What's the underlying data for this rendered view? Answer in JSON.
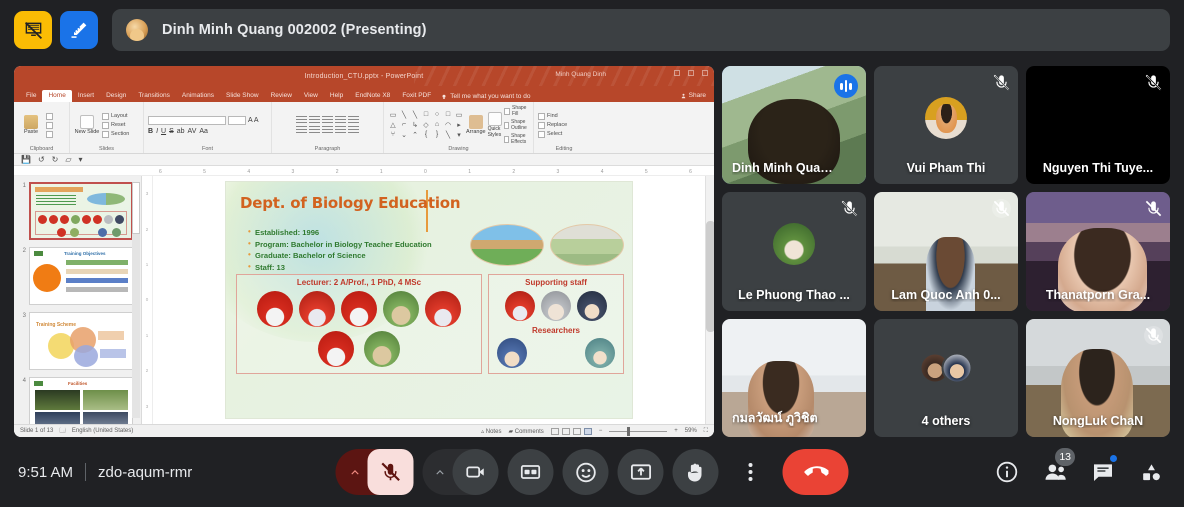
{
  "meeting": {
    "time": "9:51 AM",
    "code": "zdo-aqum-rmr",
    "presenter_banner": "Dinh Minh Quang 002002 (Presenting)",
    "accent_blue": "#1a73e8",
    "accent_yellow": "#fbbc04",
    "danger_red": "#ea4335",
    "surface": "#3c4043",
    "background": "#202124"
  },
  "topbar": {
    "stop_presenting_icon": "presentation-off-icon",
    "annotate_icon": "pen-annotate-icon",
    "avatar": "presenter-avatar"
  },
  "presentation": {
    "titlebar": "Introduction_CTU.pptx  -  PowerPoint",
    "user": "Minh Quang Dinh",
    "share_label": "Share",
    "tellme_placeholder": "Tell me what you want to do",
    "tabs": [
      "File",
      "Home",
      "Insert",
      "Design",
      "Transitions",
      "Animations",
      "Slide Show",
      "Review",
      "View",
      "Help",
      "EndNote X8",
      "Foxit PDF"
    ],
    "active_tab": "Home",
    "ribbon_groups": [
      {
        "name": "Clipboard",
        "items": [
          "Paste",
          "Cut",
          "Copy",
          "Format Painter"
        ]
      },
      {
        "name": "Slides",
        "items": [
          "New Slide",
          "Layout",
          "Reset",
          "Section"
        ]
      },
      {
        "name": "Font",
        "items": [
          "B",
          "I",
          "U",
          "S",
          "ab",
          "AV",
          "Aa"
        ]
      },
      {
        "name": "Paragraph",
        "items": []
      },
      {
        "name": "Drawing",
        "items": [
          "Arrange",
          "Quick Styles",
          "Shape Fill",
          "Shape Outline",
          "Shape Effects"
        ]
      },
      {
        "name": "Editing",
        "items": [
          "Find",
          "Replace",
          "Select"
        ]
      }
    ],
    "status": {
      "slide_counter": "Slide 1 of 13",
      "language": "English (United States)",
      "notes_label": "Notes",
      "comments_label": "Comments",
      "zoom": "59%"
    },
    "thumbnails": [
      {
        "number": "1",
        "caption": "Dept. of Biology Education",
        "selected": true
      },
      {
        "number": "2",
        "caption": "Training Objectives",
        "selected": false
      },
      {
        "number": "3",
        "caption": "Training Scheme",
        "selected": false
      },
      {
        "number": "4",
        "caption": "Facilities",
        "selected": false
      }
    ],
    "slide": {
      "title": "Dept. of Biology Education",
      "bullets": [
        "Established: 1996",
        "Program: Bachelor in Biology Teacher Education",
        "Graduate: Bachelor of Science",
        "Staff: 13"
      ],
      "panel_left_heading": "Lecturer: 2 A/Prof., 1 PhD, 4 MSc",
      "panel_right_heading": "Supporting staff",
      "researchers_heading": "Researchers",
      "lecturer_count": 7,
      "supporting_count": 3,
      "researcher_count": 2
    }
  },
  "tiles": [
    {
      "name": "Dinh Minh Quan...",
      "full": "Dinh Minh Quang 002002",
      "muted": false,
      "speaking": true,
      "active": true,
      "kind": "video-greenhouse",
      "name_align": "left"
    },
    {
      "name": "Vui Pham Thi",
      "muted": true,
      "speaking": false,
      "active": false,
      "kind": "avatar-vui",
      "name_align": "center"
    },
    {
      "name": "Nguyen Thi Tuye...",
      "muted": true,
      "speaking": false,
      "active": false,
      "kind": "camera-off-black",
      "name_align": "center"
    },
    {
      "name": "Le Phuong Thao ...",
      "muted": true,
      "speaking": false,
      "active": false,
      "kind": "avatar-thao",
      "name_align": "center"
    },
    {
      "name": "Lam Quoc Anh 0...",
      "muted": true,
      "speaking": false,
      "active": false,
      "kind": "video-office",
      "name_align": "center"
    },
    {
      "name": "Thanatporn Gra...",
      "muted": true,
      "speaking": false,
      "active": false,
      "kind": "video-temple",
      "name_align": "center"
    },
    {
      "name": "กมลวัฒน์ ภูวิชิต",
      "muted": false,
      "speaking": false,
      "active": false,
      "kind": "video-white-room",
      "name_align": "left"
    },
    {
      "name": "4 others",
      "muted": false,
      "speaking": false,
      "active": false,
      "kind": "others-stack",
      "name_align": "center"
    },
    {
      "name": "NongLuk ChaN",
      "muted": true,
      "speaking": false,
      "active": false,
      "kind": "video-nongluk",
      "name_align": "center"
    }
  ],
  "controls": [
    {
      "id": "mic",
      "label": "Turn off microphone",
      "icon": "mic-off-icon",
      "state": "muted",
      "has_chevron": true
    },
    {
      "id": "camera",
      "label": "Turn on camera",
      "icon": "camera-off-icon",
      "state": "off",
      "has_chevron": true
    },
    {
      "id": "captions",
      "label": "Turn on captions",
      "icon": "closed-captions-icon"
    },
    {
      "id": "reactions",
      "label": "Send a reaction",
      "icon": "emoji-smile-icon"
    },
    {
      "id": "present",
      "label": "Present now",
      "icon": "present-screen-icon"
    },
    {
      "id": "raise-hand",
      "label": "Raise hand",
      "icon": "raise-hand-icon"
    },
    {
      "id": "more",
      "label": "More options",
      "icon": "more-vertical-icon"
    },
    {
      "id": "leave",
      "label": "Leave call",
      "icon": "end-call-icon"
    }
  ],
  "right_panel_icons": [
    {
      "id": "info",
      "label": "Meeting details",
      "icon": "info-circle-icon",
      "badge": null,
      "dot": false
    },
    {
      "id": "people",
      "label": "Show everyone",
      "icon": "people-icon",
      "badge": "13",
      "dot": false
    },
    {
      "id": "chat",
      "label": "Chat with everyone",
      "icon": "chat-bubble-icon",
      "badge": null,
      "dot": true
    },
    {
      "id": "activities",
      "label": "Activities",
      "icon": "activities-shapes-icon",
      "badge": null,
      "dot": false
    }
  ]
}
